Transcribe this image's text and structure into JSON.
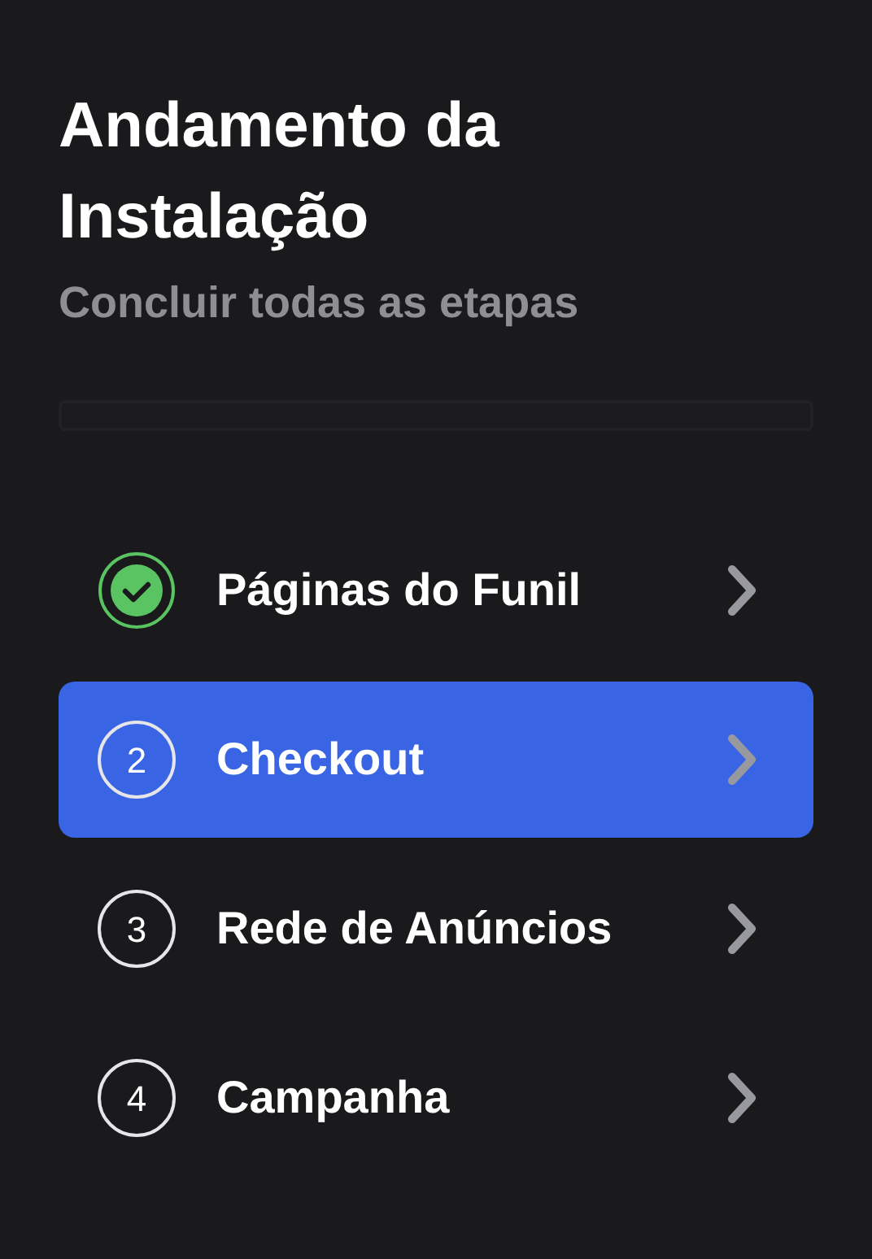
{
  "header": {
    "title": "Andamento da Instalação",
    "subtitle": "Concluir todas as etapas"
  },
  "progress": {
    "level": 0
  },
  "steps": [
    {
      "kind": "done",
      "label": "Páginas do Funil",
      "selected": false
    },
    {
      "kind": "numbered",
      "number": "2",
      "label": "Checkout",
      "selected": true
    },
    {
      "kind": "numbered",
      "number": "3",
      "label": "Rede de Anúncios",
      "selected": false
    },
    {
      "kind": "numbered",
      "number": "4",
      "label": "Campanha",
      "selected": false
    }
  ]
}
